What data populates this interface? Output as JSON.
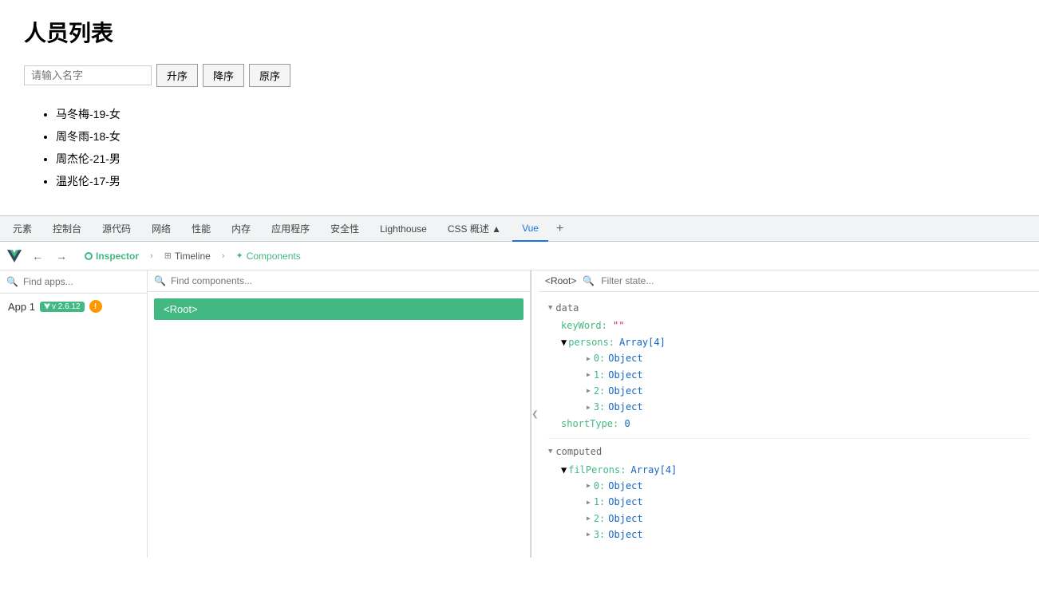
{
  "app": {
    "title": "人员列表",
    "input_placeholder": "请输入名字",
    "buttons": {
      "asc": "升序",
      "desc": "降序",
      "original": "原序"
    },
    "persons": [
      "马冬梅-19-女",
      "周冬雨-18-女",
      "周杰伦-21-男",
      "温兆伦-17-男"
    ]
  },
  "devtools": {
    "tabs": [
      {
        "label": "元素",
        "active": false
      },
      {
        "label": "控制台",
        "active": false
      },
      {
        "label": "源代码",
        "active": false
      },
      {
        "label": "网络",
        "active": false
      },
      {
        "label": "性能",
        "active": false
      },
      {
        "label": "内存",
        "active": false
      },
      {
        "label": "应用程序",
        "active": false
      },
      {
        "label": "安全性",
        "active": false
      },
      {
        "label": "Lighthouse",
        "active": false
      },
      {
        "label": "CSS 概述",
        "active": false
      },
      {
        "label": "Vue",
        "active": true
      }
    ],
    "vue": {
      "subtabs": [
        {
          "label": "Inspector",
          "active": true,
          "icon": "circle"
        },
        {
          "label": "Timeline",
          "active": false,
          "icon": "grid"
        },
        {
          "label": "Components",
          "active": false,
          "icon": "people"
        }
      ],
      "left": {
        "find_placeholder": "Find apps...",
        "app_name": "App 1",
        "vue_version": "v 2.6.12"
      },
      "mid": {
        "find_placeholder": "Find components...",
        "root_label": "<Root>"
      },
      "right": {
        "root_tag": "<Root>",
        "filter_placeholder": "Filter state...",
        "data_section": "data",
        "keyword_prop": "keyWord:",
        "keyword_val": "\"\"",
        "persons_prop": "persons:",
        "persons_type": "Array[4]",
        "persons_items": [
          "0: Object",
          "1: Object",
          "2: Object",
          "3: Object"
        ],
        "shorttype_prop": "shortType:",
        "shorttype_val": "0",
        "computed_section": "computed",
        "filperons_prop": "filPerons:",
        "filperons_type": "Array[4]",
        "filperons_items": [
          "0: Object",
          "1: Object",
          "2: Object",
          "3: Object"
        ]
      }
    }
  }
}
